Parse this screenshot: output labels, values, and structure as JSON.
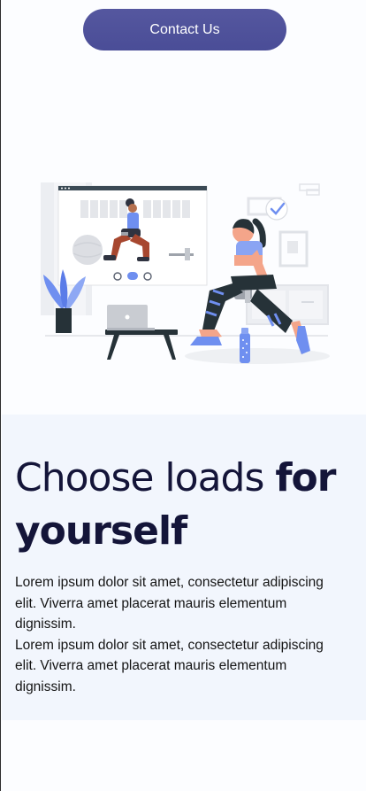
{
  "header": {
    "contact_label": "Contact Us"
  },
  "hero": {
    "heading_light": "Choose loads ",
    "heading_bold_1": "for",
    "heading_bold_2": "yourself",
    "paragraph_1": "Lorem ipsum dolor sit amet, consectetur adipiscing elit. Viverra amet placerat mauris elementum dignissim.",
    "paragraph_2": "Lorem ipsum dolor sit amet, consectetur adipiscing elit. Viverra amet placerat mauris elementum dignissim."
  },
  "colors": {
    "button": "#4f529b",
    "section_bg": "#f2f6fd",
    "heading": "#141539",
    "accent_blue": "#6f8ff0"
  },
  "icons": {
    "illustration": "workout-illustration",
    "check": "check-icon"
  }
}
